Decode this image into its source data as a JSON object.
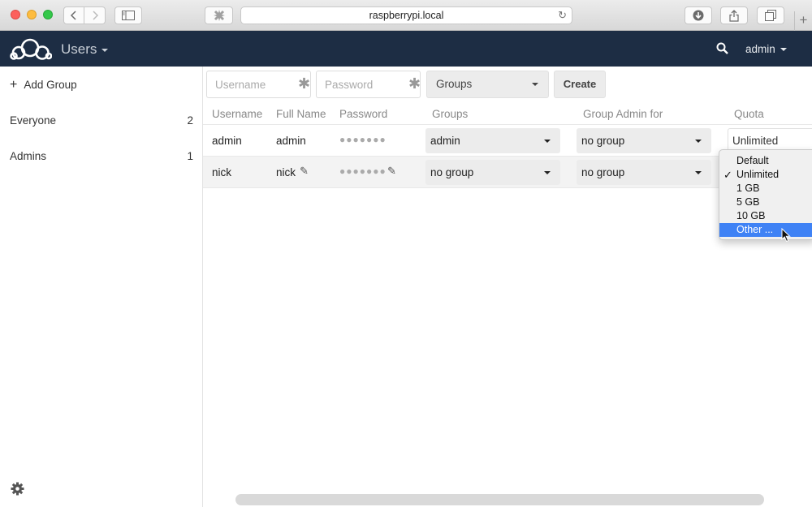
{
  "browser": {
    "url": "raspberrypi.local",
    "new_tab_glyph": "+"
  },
  "header": {
    "app_name": "Users",
    "user": "admin",
    "bg_color": "#1d2d44"
  },
  "sidebar": {
    "add_group_label": "Add Group",
    "add_group_icon": "+",
    "groups": [
      {
        "name": "Everyone",
        "count": "2"
      },
      {
        "name": "Admins",
        "count": "1"
      }
    ]
  },
  "new_user": {
    "username_placeholder": "Username",
    "password_placeholder": "Password",
    "groups_label": "Groups",
    "create_label": "Create"
  },
  "table": {
    "headers": {
      "username": "Username",
      "full_name": "Full Name",
      "password": "Password",
      "groups": "Groups",
      "group_admin": "Group Admin for",
      "quota": "Quota"
    },
    "rows": [
      {
        "username": "admin",
        "full_name": "admin",
        "password_mask": "●●●●●●●",
        "groups": "admin",
        "group_admin": "no group",
        "quota": "Unlimited"
      },
      {
        "username": "nick",
        "full_name": "nick",
        "password_mask": "●●●●●●●",
        "groups": "no group",
        "group_admin": "no group",
        "quota": ""
      }
    ]
  },
  "quota_menu": {
    "options": [
      "Default",
      "Unlimited",
      "1 GB",
      "5 GB",
      "10 GB",
      "Other ..."
    ],
    "checked": "Unlimited",
    "highlighted": "Other ...",
    "highlight_color": "#3f82f5"
  }
}
